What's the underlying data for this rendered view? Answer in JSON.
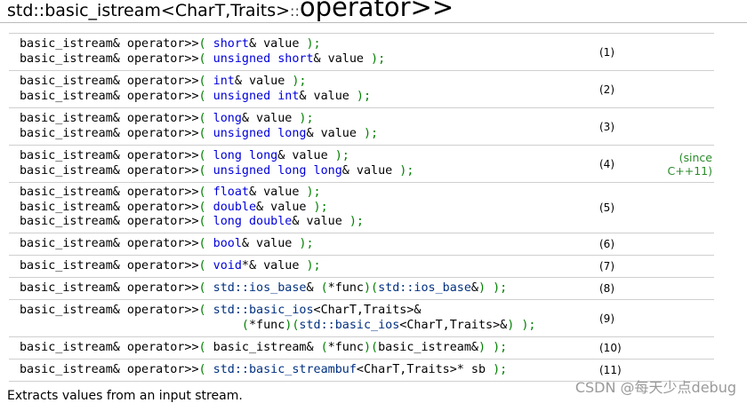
{
  "title": {
    "prefix": "std::basic_istream<CharT,Traits>",
    "sep": "::",
    "name": "operator>>"
  },
  "rows": [
    {
      "number": "(1)",
      "since": "",
      "height": 42,
      "lines": [
        [
          [
            "f",
            "basic_istream& operator>>"
          ],
          [
            "p",
            "( "
          ],
          [
            "k",
            "short"
          ],
          [
            "f",
            "& value "
          ],
          [
            "p",
            ");"
          ]
        ],
        [
          [
            "f",
            "basic_istream& operator>>"
          ],
          [
            "p",
            "( "
          ],
          [
            "k",
            "unsigned"
          ],
          [
            "f",
            " "
          ],
          [
            "k",
            "short"
          ],
          [
            "f",
            "& value "
          ],
          [
            "p",
            ");"
          ]
        ]
      ]
    },
    {
      "number": "(2)",
      "since": "",
      "height": 42,
      "lines": [
        [
          [
            "f",
            "basic_istream& operator>>"
          ],
          [
            "p",
            "( "
          ],
          [
            "k",
            "int"
          ],
          [
            "f",
            "& value "
          ],
          [
            "p",
            ");"
          ]
        ],
        [
          [
            "f",
            "basic_istream& operator>>"
          ],
          [
            "p",
            "( "
          ],
          [
            "k",
            "unsigned"
          ],
          [
            "f",
            " "
          ],
          [
            "k",
            "int"
          ],
          [
            "f",
            "& value "
          ],
          [
            "p",
            ");"
          ]
        ]
      ]
    },
    {
      "number": "(3)",
      "since": "",
      "height": 42,
      "lines": [
        [
          [
            "f",
            "basic_istream& operator>>"
          ],
          [
            "p",
            "( "
          ],
          [
            "k",
            "long"
          ],
          [
            "f",
            "& value "
          ],
          [
            "p",
            ");"
          ]
        ],
        [
          [
            "f",
            "basic_istream& operator>>"
          ],
          [
            "p",
            "( "
          ],
          [
            "k",
            "unsigned"
          ],
          [
            "f",
            " "
          ],
          [
            "k",
            "long"
          ],
          [
            "f",
            "& value "
          ],
          [
            "p",
            ");"
          ]
        ]
      ]
    },
    {
      "number": "(4)",
      "since": "(since C++11)",
      "height": 42,
      "lines": [
        [
          [
            "f",
            "basic_istream& operator>>"
          ],
          [
            "p",
            "( "
          ],
          [
            "k",
            "long"
          ],
          [
            "f",
            " "
          ],
          [
            "k",
            "long"
          ],
          [
            "f",
            "& value "
          ],
          [
            "p",
            ");"
          ]
        ],
        [
          [
            "f",
            "basic_istream& operator>>"
          ],
          [
            "p",
            "( "
          ],
          [
            "k",
            "unsigned"
          ],
          [
            "f",
            " "
          ],
          [
            "k",
            "long"
          ],
          [
            "f",
            " "
          ],
          [
            "k",
            "long"
          ],
          [
            "f",
            "& value "
          ],
          [
            "p",
            ");"
          ]
        ]
      ]
    },
    {
      "number": "(5)",
      "since": "",
      "height": 57,
      "lines": [
        [
          [
            "f",
            "basic_istream& operator>>"
          ],
          [
            "p",
            "( "
          ],
          [
            "k",
            "float"
          ],
          [
            "f",
            "& value "
          ],
          [
            "p",
            ");"
          ]
        ],
        [
          [
            "f",
            "basic_istream& operator>>"
          ],
          [
            "p",
            "( "
          ],
          [
            "k",
            "double"
          ],
          [
            "f",
            "& value "
          ],
          [
            "p",
            ");"
          ]
        ],
        [
          [
            "f",
            "basic_istream& operator>>"
          ],
          [
            "p",
            "( "
          ],
          [
            "k",
            "long"
          ],
          [
            "f",
            " "
          ],
          [
            "k",
            "double"
          ],
          [
            "f",
            "& value "
          ],
          [
            "p",
            ");"
          ]
        ]
      ]
    },
    {
      "number": "(6)",
      "since": "",
      "height": 25,
      "lines": [
        [
          [
            "f",
            "basic_istream& operator>>"
          ],
          [
            "p",
            "( "
          ],
          [
            "k",
            "bool"
          ],
          [
            "f",
            "& value "
          ],
          [
            "p",
            ");"
          ]
        ]
      ]
    },
    {
      "number": "(7)",
      "since": "",
      "height": 25,
      "lines": [
        [
          [
            "f",
            "basic_istream& operator>>"
          ],
          [
            "p",
            "( "
          ],
          [
            "k",
            "void"
          ],
          [
            "f",
            "*& value "
          ],
          [
            "p",
            ");"
          ]
        ]
      ]
    },
    {
      "number": "(8)",
      "since": "",
      "height": 25,
      "lines": [
        [
          [
            "f",
            "basic_istream& operator>>"
          ],
          [
            "p",
            "( "
          ],
          [
            "t",
            "std::ios_base"
          ],
          [
            "f",
            "& "
          ],
          [
            "p",
            "("
          ],
          [
            "f",
            "*func"
          ],
          [
            "p",
            ")("
          ],
          [
            "t",
            "std::ios_base"
          ],
          [
            "f",
            "&"
          ],
          [
            "p",
            ") );"
          ]
        ]
      ]
    },
    {
      "number": "(9)",
      "since": "",
      "height": 42,
      "lines": [
        [
          [
            "f",
            "basic_istream& operator>>"
          ],
          [
            "p",
            "( "
          ],
          [
            "t",
            "std::basic_ios"
          ],
          [
            "f",
            "<CharT,Traits>&"
          ]
        ],
        [
          [
            "f",
            "                               "
          ],
          [
            "p",
            "("
          ],
          [
            "f",
            "*func"
          ],
          [
            "p",
            ")("
          ],
          [
            "t",
            "std::basic_ios"
          ],
          [
            "f",
            "<CharT,Traits>&"
          ],
          [
            "p",
            ") );"
          ]
        ]
      ]
    },
    {
      "number": "(10)",
      "since": "",
      "height": 25,
      "lines": [
        [
          [
            "f",
            "basic_istream& operator>>"
          ],
          [
            "p",
            "( "
          ],
          [
            "f",
            "basic_istream& "
          ],
          [
            "p",
            "("
          ],
          [
            "f",
            "*func"
          ],
          [
            "p",
            ")("
          ],
          [
            "f",
            "basic_istream&"
          ],
          [
            "p",
            ") );"
          ]
        ]
      ]
    },
    {
      "number": "(11)",
      "since": "",
      "height": 25,
      "lines": [
        [
          [
            "f",
            "basic_istream& operator>>"
          ],
          [
            "p",
            "( "
          ],
          [
            "t",
            "std::basic_streambuf"
          ],
          [
            "f",
            "<CharT,Traits>* sb "
          ],
          [
            "p",
            ");"
          ]
        ]
      ]
    }
  ],
  "description": "Extracts values from an input stream.",
  "watermark": "CSDN @每天少点debug"
}
